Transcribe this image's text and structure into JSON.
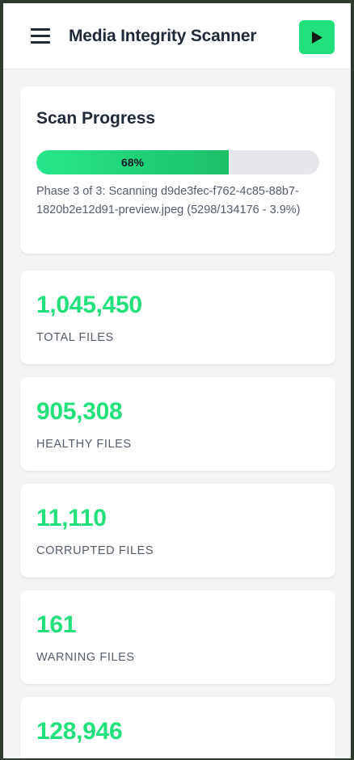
{
  "header": {
    "title": "Media Integrity Scanner",
    "menu_icon": "hamburger-menu-icon",
    "play_icon": "play-icon"
  },
  "colors": {
    "accent": "#22e07a",
    "text": "#1f2937",
    "muted": "#555d6b",
    "track": "#e5e7eb"
  },
  "progress": {
    "title": "Scan Progress",
    "percent": 68,
    "percent_label": "68%",
    "phase_text": "Phase 3 of 3: Scanning d9de3fec-f762-4c85-88b7-1820b2e12d91-preview.jpeg (5298/134176 - 3.9%)"
  },
  "stats": [
    {
      "value": "1,045,450",
      "label": "TOTAL FILES"
    },
    {
      "value": "905,308",
      "label": "HEALTHY FILES"
    },
    {
      "value": "11,110",
      "label": "CORRUPTED FILES"
    },
    {
      "value": "161",
      "label": "WARNING FILES"
    },
    {
      "value": "128,946",
      "label": ""
    }
  ]
}
